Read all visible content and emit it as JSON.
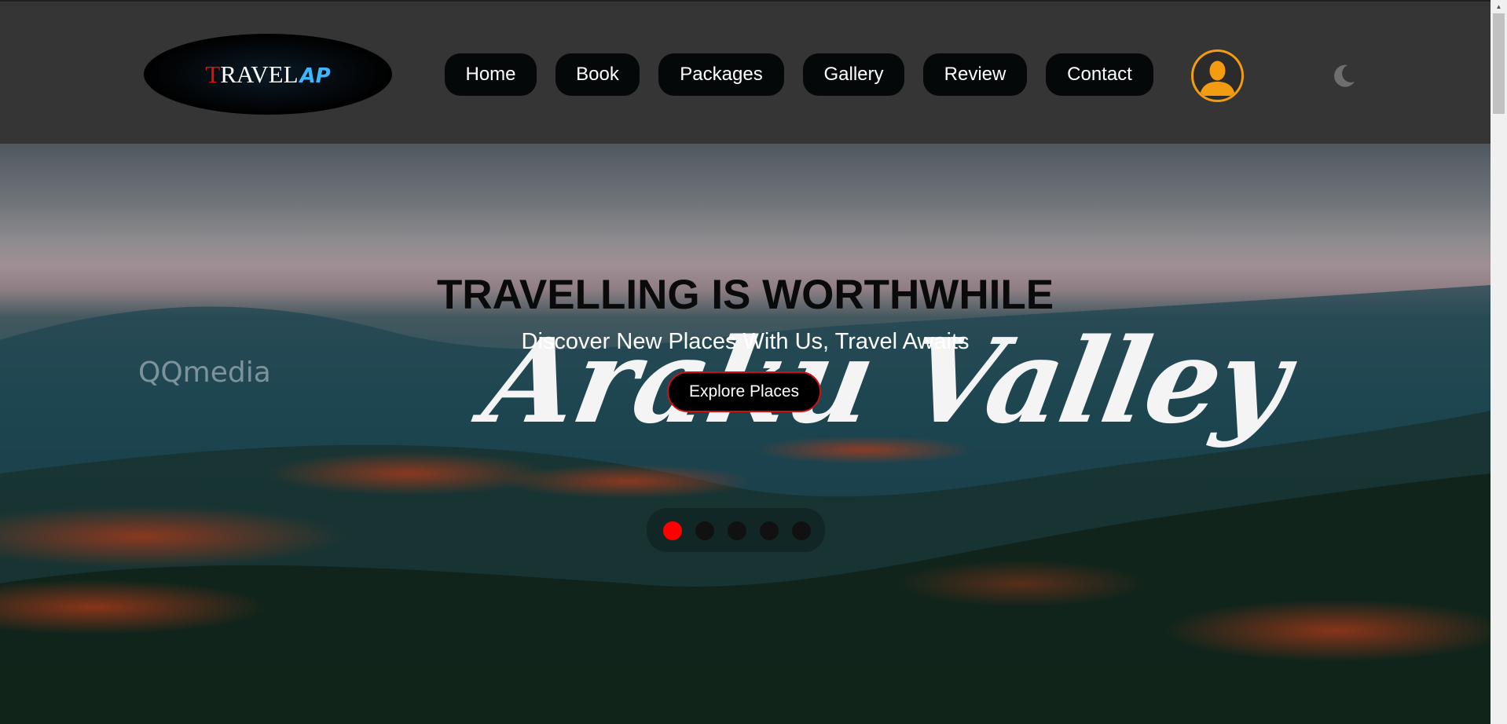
{
  "brand": {
    "logo_first": "T",
    "logo_rest": "RAVEL",
    "logo_suffix": "AP"
  },
  "nav": {
    "items": [
      {
        "label": "Home"
      },
      {
        "label": "Book"
      },
      {
        "label": "Packages"
      },
      {
        "label": "Gallery"
      },
      {
        "label": "Review"
      },
      {
        "label": "Contact"
      }
    ]
  },
  "header": {
    "avatar_icon": "user-avatar-icon",
    "theme_toggle_icon": "moon-icon"
  },
  "hero": {
    "title": "TRAVELLING IS WORTHWHILE",
    "subtitle": "Discover New Places With Us, Travel Awaits",
    "cta_label": "Explore Places",
    "background_overlay_text": "Araku Valley",
    "watermark": "QQmedia",
    "slides_count": 5,
    "active_slide": 1
  },
  "colors": {
    "header_bg": "#353535",
    "nav_button_bg": "#050809",
    "avatar_ring": "#f39c12",
    "active_dot": "#ff0000",
    "cta_border": "#d01010",
    "logo_t": "#e01010",
    "logo_ap": "#3bb6ff"
  }
}
